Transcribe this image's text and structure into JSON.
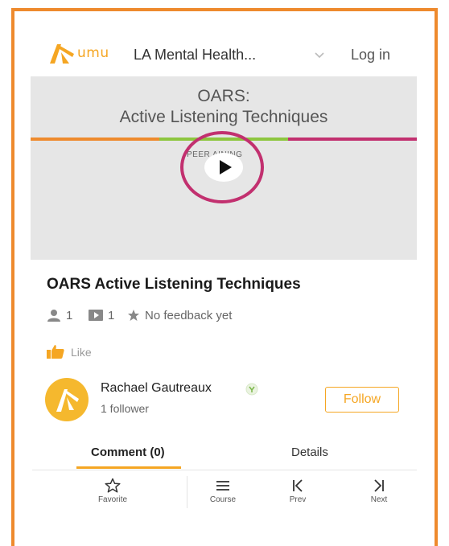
{
  "header": {
    "logo_text": "umu",
    "org_name": "LA Mental Health...",
    "login_label": "Log in"
  },
  "video": {
    "title_line1": "OARS:",
    "title_line2": "Active Listening Techniques",
    "overlay_label": "PEER   AINING"
  },
  "content": {
    "title": "OARS Active Listening Techniques",
    "learners": "1",
    "videos": "1",
    "feedback": "No feedback yet",
    "like_label": "Like"
  },
  "author": {
    "name": "Rachael Gautreaux",
    "followers": "1 follower",
    "follow_label": "Follow"
  },
  "tabs": [
    {
      "label": "Comment (0)",
      "active": true
    },
    {
      "label": "Details",
      "active": false
    }
  ],
  "bottom_bar": [
    {
      "label": "Favorite",
      "icon": "star-outline-icon"
    },
    {
      "label": "Course",
      "icon": "menu-icon"
    },
    {
      "label": "Prev",
      "icon": "prev-icon"
    },
    {
      "label": "Next",
      "icon": "next-icon"
    }
  ],
  "colors": {
    "frame": "#ee8a2d",
    "accent": "#f5a623",
    "highlight_ring": "#c2306f",
    "stripe_green": "#8dc63f"
  }
}
